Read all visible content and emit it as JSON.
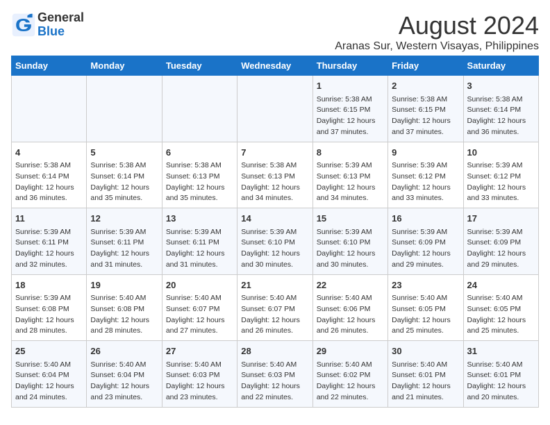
{
  "logo": {
    "general": "General",
    "blue": "Blue"
  },
  "title": "August 2024",
  "subtitle": "Aranas Sur, Western Visayas, Philippines",
  "headers": [
    "Sunday",
    "Monday",
    "Tuesday",
    "Wednesday",
    "Thursday",
    "Friday",
    "Saturday"
  ],
  "weeks": [
    [
      {
        "day": "",
        "info": ""
      },
      {
        "day": "",
        "info": ""
      },
      {
        "day": "",
        "info": ""
      },
      {
        "day": "",
        "info": ""
      },
      {
        "day": "1",
        "info": "Sunrise: 5:38 AM\nSunset: 6:15 PM\nDaylight: 12 hours\nand 37 minutes."
      },
      {
        "day": "2",
        "info": "Sunrise: 5:38 AM\nSunset: 6:15 PM\nDaylight: 12 hours\nand 37 minutes."
      },
      {
        "day": "3",
        "info": "Sunrise: 5:38 AM\nSunset: 6:14 PM\nDaylight: 12 hours\nand 36 minutes."
      }
    ],
    [
      {
        "day": "4",
        "info": "Sunrise: 5:38 AM\nSunset: 6:14 PM\nDaylight: 12 hours\nand 36 minutes."
      },
      {
        "day": "5",
        "info": "Sunrise: 5:38 AM\nSunset: 6:14 PM\nDaylight: 12 hours\nand 35 minutes."
      },
      {
        "day": "6",
        "info": "Sunrise: 5:38 AM\nSunset: 6:13 PM\nDaylight: 12 hours\nand 35 minutes."
      },
      {
        "day": "7",
        "info": "Sunrise: 5:38 AM\nSunset: 6:13 PM\nDaylight: 12 hours\nand 34 minutes."
      },
      {
        "day": "8",
        "info": "Sunrise: 5:39 AM\nSunset: 6:13 PM\nDaylight: 12 hours\nand 34 minutes."
      },
      {
        "day": "9",
        "info": "Sunrise: 5:39 AM\nSunset: 6:12 PM\nDaylight: 12 hours\nand 33 minutes."
      },
      {
        "day": "10",
        "info": "Sunrise: 5:39 AM\nSunset: 6:12 PM\nDaylight: 12 hours\nand 33 minutes."
      }
    ],
    [
      {
        "day": "11",
        "info": "Sunrise: 5:39 AM\nSunset: 6:11 PM\nDaylight: 12 hours\nand 32 minutes."
      },
      {
        "day": "12",
        "info": "Sunrise: 5:39 AM\nSunset: 6:11 PM\nDaylight: 12 hours\nand 31 minutes."
      },
      {
        "day": "13",
        "info": "Sunrise: 5:39 AM\nSunset: 6:11 PM\nDaylight: 12 hours\nand 31 minutes."
      },
      {
        "day": "14",
        "info": "Sunrise: 5:39 AM\nSunset: 6:10 PM\nDaylight: 12 hours\nand 30 minutes."
      },
      {
        "day": "15",
        "info": "Sunrise: 5:39 AM\nSunset: 6:10 PM\nDaylight: 12 hours\nand 30 minutes."
      },
      {
        "day": "16",
        "info": "Sunrise: 5:39 AM\nSunset: 6:09 PM\nDaylight: 12 hours\nand 29 minutes."
      },
      {
        "day": "17",
        "info": "Sunrise: 5:39 AM\nSunset: 6:09 PM\nDaylight: 12 hours\nand 29 minutes."
      }
    ],
    [
      {
        "day": "18",
        "info": "Sunrise: 5:39 AM\nSunset: 6:08 PM\nDaylight: 12 hours\nand 28 minutes."
      },
      {
        "day": "19",
        "info": "Sunrise: 5:40 AM\nSunset: 6:08 PM\nDaylight: 12 hours\nand 28 minutes."
      },
      {
        "day": "20",
        "info": "Sunrise: 5:40 AM\nSunset: 6:07 PM\nDaylight: 12 hours\nand 27 minutes."
      },
      {
        "day": "21",
        "info": "Sunrise: 5:40 AM\nSunset: 6:07 PM\nDaylight: 12 hours\nand 26 minutes."
      },
      {
        "day": "22",
        "info": "Sunrise: 5:40 AM\nSunset: 6:06 PM\nDaylight: 12 hours\nand 26 minutes."
      },
      {
        "day": "23",
        "info": "Sunrise: 5:40 AM\nSunset: 6:05 PM\nDaylight: 12 hours\nand 25 minutes."
      },
      {
        "day": "24",
        "info": "Sunrise: 5:40 AM\nSunset: 6:05 PM\nDaylight: 12 hours\nand 25 minutes."
      }
    ],
    [
      {
        "day": "25",
        "info": "Sunrise: 5:40 AM\nSunset: 6:04 PM\nDaylight: 12 hours\nand 24 minutes."
      },
      {
        "day": "26",
        "info": "Sunrise: 5:40 AM\nSunset: 6:04 PM\nDaylight: 12 hours\nand 23 minutes."
      },
      {
        "day": "27",
        "info": "Sunrise: 5:40 AM\nSunset: 6:03 PM\nDaylight: 12 hours\nand 23 minutes."
      },
      {
        "day": "28",
        "info": "Sunrise: 5:40 AM\nSunset: 6:03 PM\nDaylight: 12 hours\nand 22 minutes."
      },
      {
        "day": "29",
        "info": "Sunrise: 5:40 AM\nSunset: 6:02 PM\nDaylight: 12 hours\nand 22 minutes."
      },
      {
        "day": "30",
        "info": "Sunrise: 5:40 AM\nSunset: 6:01 PM\nDaylight: 12 hours\nand 21 minutes."
      },
      {
        "day": "31",
        "info": "Sunrise: 5:40 AM\nSunset: 6:01 PM\nDaylight: 12 hours\nand 20 minutes."
      }
    ]
  ]
}
